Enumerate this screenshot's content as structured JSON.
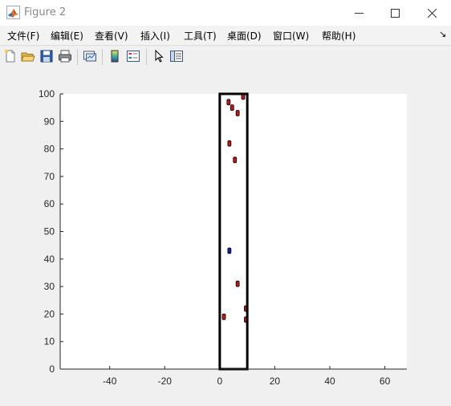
{
  "window": {
    "title": "Figure 2",
    "controls": [
      "minimize",
      "maximize",
      "close"
    ]
  },
  "menubar": {
    "items": [
      {
        "label": "文件(F)"
      },
      {
        "label": "编辑(E)"
      },
      {
        "label": "查看(V)"
      },
      {
        "label": "插入(I)"
      },
      {
        "label": "工具(T)"
      },
      {
        "label": "桌面(D)"
      },
      {
        "label": "窗口(W)"
      },
      {
        "label": "帮助(H)"
      }
    ],
    "overflow_glyph": "↘"
  },
  "toolbar": {
    "buttons": [
      {
        "icon": "new-file-icon"
      },
      {
        "icon": "open-folder-icon"
      },
      {
        "icon": "save-icon"
      },
      {
        "icon": "print-icon"
      },
      {
        "icon": "link-plot-icon"
      },
      {
        "icon": "colorbar-icon"
      },
      {
        "icon": "legend-icon"
      },
      {
        "icon": "pointer-icon"
      },
      {
        "icon": "property-inspector-icon"
      }
    ]
  },
  "colors": {
    "marker_red": "#c01818",
    "marker_blue": "#1020a0",
    "marker_edge": "#000000",
    "axes_bg": "#ffffff",
    "rect_stroke": "#000000"
  },
  "chart_data": {
    "type": "scatter",
    "title": "",
    "xlabel": "",
    "ylabel": "",
    "xlim": [
      -58,
      68
    ],
    "ylim": [
      0,
      100
    ],
    "xticks": [
      -40,
      -20,
      0,
      20,
      40,
      60
    ],
    "yticks": [
      0,
      10,
      20,
      30,
      40,
      50,
      60,
      70,
      80,
      90,
      100
    ],
    "grid": false,
    "rectangle": {
      "x": [
        0,
        10
      ],
      "y": [
        0,
        100
      ]
    },
    "series": [
      {
        "color": "#c01818",
        "x": [
          8.5,
          3.2,
          4.5,
          6.5,
          3.5,
          5.5,
          6.5,
          9.5,
          9.5,
          1.5
        ],
        "y": [
          99,
          97,
          95,
          93,
          82,
          76,
          31,
          22,
          18,
          19
        ]
      },
      {
        "color": "#1020a0",
        "x": [
          3.5
        ],
        "y": [
          43
        ]
      }
    ]
  }
}
